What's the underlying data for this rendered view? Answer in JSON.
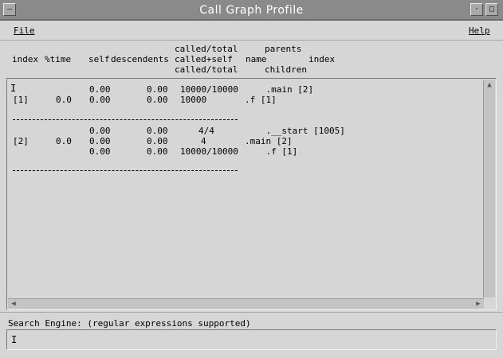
{
  "window": {
    "title": "Call Graph Profile"
  },
  "menubar": {
    "file": "File",
    "help": "Help"
  },
  "header": {
    "index": "index",
    "pct_time": "%time",
    "self": "self",
    "descendents": "descendents",
    "called_line1": "called/total",
    "called_line2": "called+self",
    "called_line3": "called/total",
    "parents": "parents",
    "name": "name",
    "index2": "index",
    "children": "children"
  },
  "rows": [
    {
      "index": "",
      "time": "",
      "self": "0.00",
      "desc": "0.00",
      "called": "10000/10000",
      "name": "    .main [2]"
    },
    {
      "index": "[1]",
      "time": "0.0",
      "self": "0.00",
      "desc": "0.00",
      "called": "10000",
      "name": ".f [1]"
    },
    {
      "index": "",
      "time": "",
      "self": "0.00",
      "desc": "0.00",
      "called": "4/4",
      "name": "    .__start [1005]"
    },
    {
      "index": "[2]",
      "time": "0.0",
      "self": "0.00",
      "desc": "0.00",
      "called": "4",
      "name": ".main [2]"
    },
    {
      "index": "",
      "time": "",
      "self": "0.00",
      "desc": "0.00",
      "called": "10000/10000",
      "name": "    .f [1]"
    }
  ],
  "search": {
    "label": "Search Engine: (regular expressions supported)",
    "value": ""
  }
}
